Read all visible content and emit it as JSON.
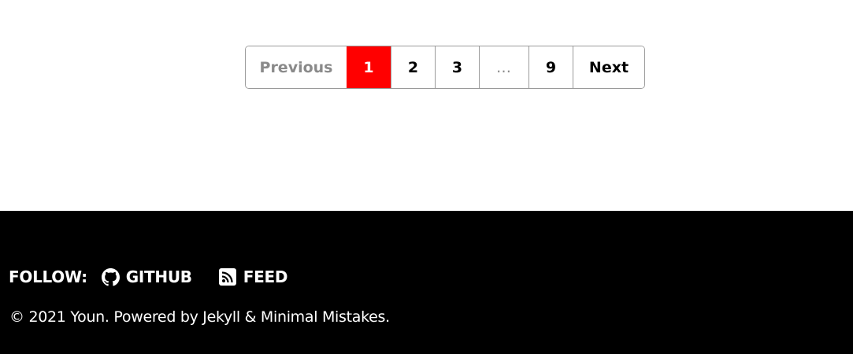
{
  "pagination": {
    "previous_label": "Previous",
    "pages": [
      {
        "label": "1",
        "current": true
      },
      {
        "label": "2",
        "current": false
      },
      {
        "label": "3",
        "current": false
      },
      {
        "label": "…",
        "ellipsis": true
      },
      {
        "label": "9",
        "current": false
      }
    ],
    "next_label": "Next",
    "current_color": "#ff0000"
  },
  "footer": {
    "follow_label": "FOLLOW:",
    "links": [
      {
        "label": "GITHUB",
        "icon": "github-icon"
      },
      {
        "label": "FEED",
        "icon": "rss-feed-icon"
      }
    ],
    "copyright": "© 2021 Youn. Powered by Jekyll & Minimal Mistakes.",
    "background_color": "#000000"
  }
}
